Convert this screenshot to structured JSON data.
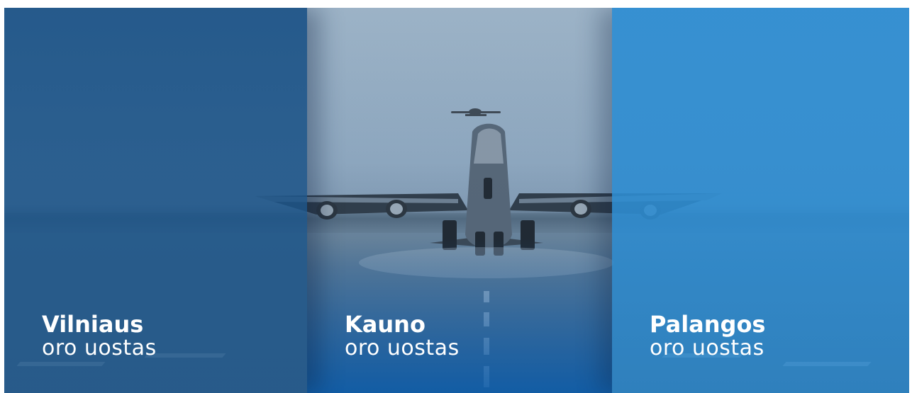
{
  "airports": [
    {
      "name": "Vilniaus",
      "subtitle": "oro uostas",
      "color": "#1b5286"
    },
    {
      "name": "Kauno",
      "subtitle": "oro uostas",
      "color": "#0a5aaa"
    },
    {
      "name": "Palangos",
      "subtitle": "oro uostas",
      "color": "#308ed2"
    }
  ],
  "background": {
    "image": "airliner-takeoff-photo",
    "sky_color": "#9fb5c8"
  }
}
